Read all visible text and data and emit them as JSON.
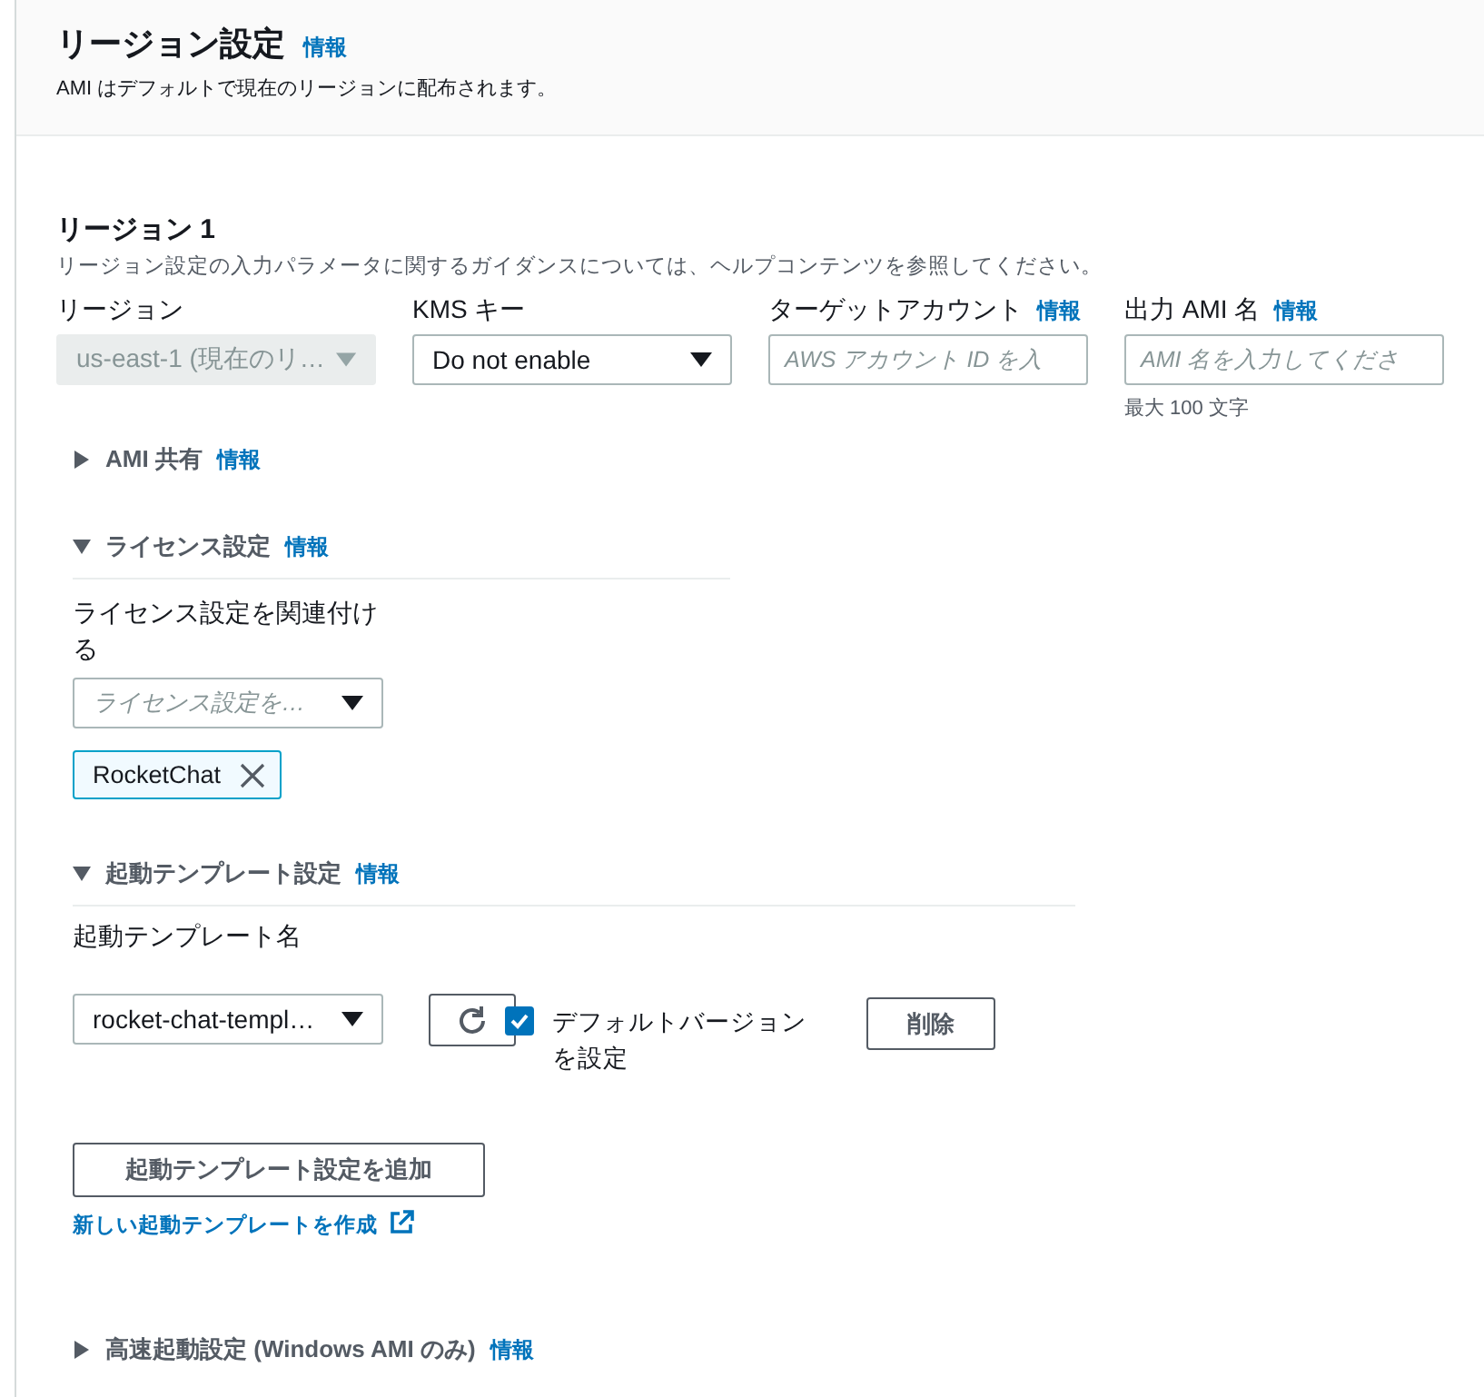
{
  "panel": {
    "title": "リージョン設定",
    "info": "情報",
    "description": "AMI はデフォルトで現在のリージョンに配布されます。"
  },
  "region": {
    "title": "リージョン 1",
    "description": "リージョン設定の入力パラメータに関するガイダンスについては、ヘルプコンテンツを参照してください。",
    "fields": [
      {
        "kind": "select",
        "label": "リージョン",
        "value": "us-east-1 (現在のリ…",
        "disabled": true
      },
      {
        "kind": "select",
        "label": "KMS キー",
        "value": "Do not enable",
        "disabled": false
      },
      {
        "kind": "input",
        "label": "ターゲットアカウント",
        "info": "情報",
        "placeholder": "AWS アカウント ID を入"
      },
      {
        "kind": "input",
        "label": "出力 AMI 名",
        "info": "情報",
        "placeholder": "AMI 名を入力してくださ",
        "hint": "最大 100 文字"
      }
    ]
  },
  "sections": [
    {
      "kind": "plain",
      "title": "AMI 共有",
      "info": "情報",
      "expanded": false
    },
    {
      "kind": "license",
      "title": "ライセンス設定",
      "info": "情報",
      "expanded": true,
      "label": "ライセンス設定を関連付ける",
      "placeholder": "ライセンス設定を…",
      "tokens": [
        "RocketChat"
      ]
    },
    {
      "kind": "template",
      "title": "起動テンプレート設定",
      "info": "情報",
      "expanded": true,
      "label": "起動テンプレート名",
      "value": "rocket-chat-templ…",
      "default_version": {
        "label": "デフォルトバージョンを設定",
        "checked": true
      },
      "delete_button": "削除",
      "add_button": "起動テンプレート設定を追加",
      "create_link": "新しい起動テンプレートを作成"
    },
    {
      "kind": "plain",
      "title": "高速起動設定 (Windows AMI のみ)",
      "info": "情報",
      "expanded": false
    }
  ]
}
